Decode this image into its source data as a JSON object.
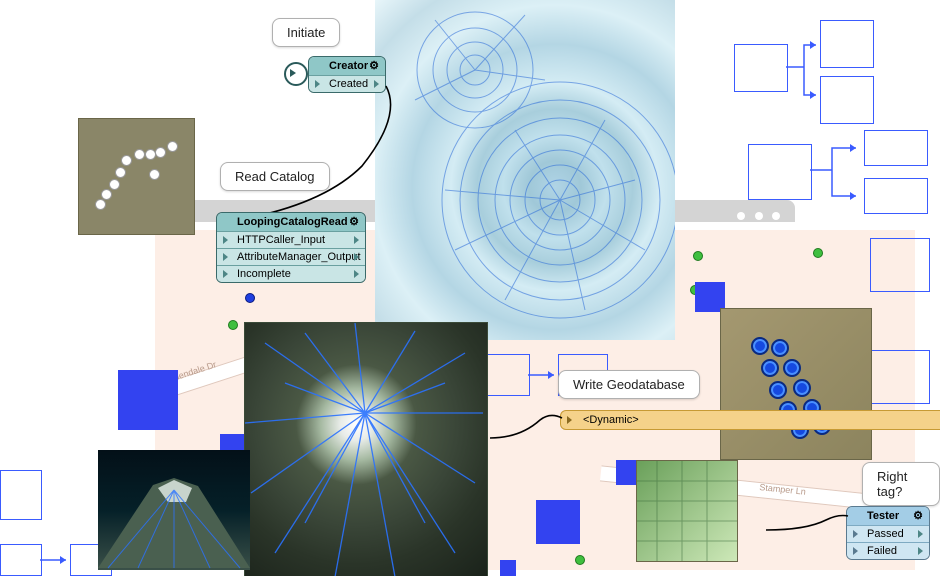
{
  "callouts": {
    "initiate": "Initiate",
    "read_catalog": "Read Catalog",
    "write_geodatabase": "Write Geodatabase",
    "right_tag": "Right tag?"
  },
  "nodes": {
    "creator": {
      "title": "Creator",
      "ports": [
        "Created"
      ]
    },
    "loopingCatalogRead": {
      "title": "LoopingCatalogRead",
      "ports": [
        "HTTPCaller_Input",
        "AttributeManager_Output",
        "Incomplete"
      ]
    },
    "dynamic": {
      "label": "<Dynamic>"
    },
    "tester": {
      "title": "Tester",
      "ports": [
        "Passed",
        "Failed"
      ]
    }
  },
  "icons": {
    "gear": "⚙"
  },
  "road_labels": {
    "bullendale": "Bullendale Dr",
    "stamper": "Stamper Ln"
  }
}
